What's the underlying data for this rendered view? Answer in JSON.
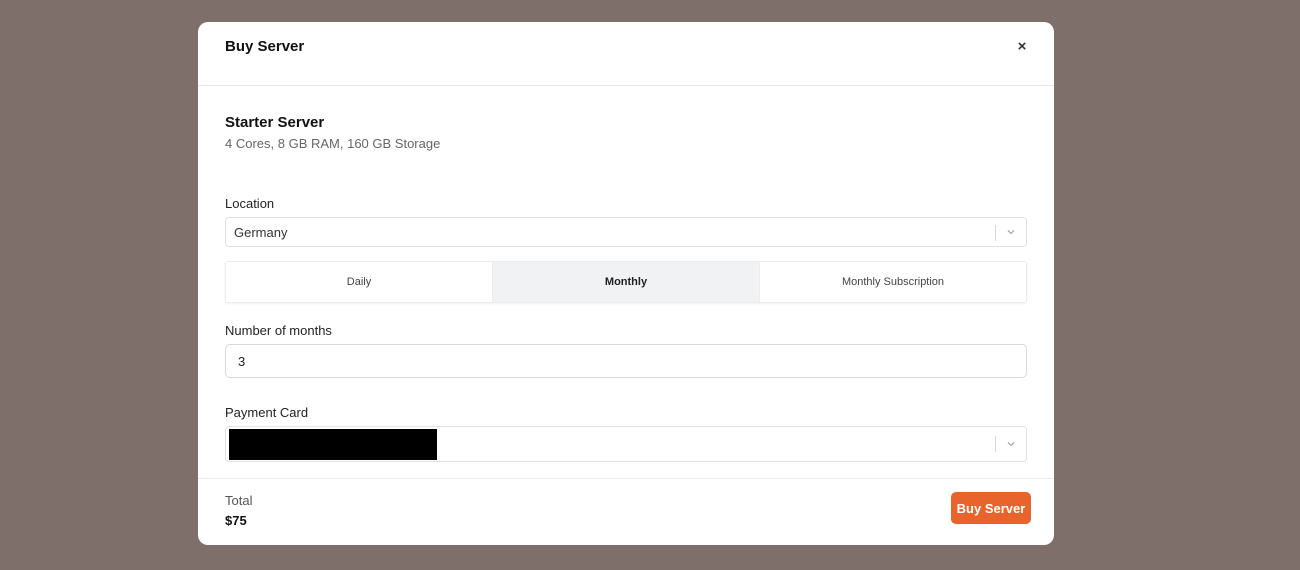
{
  "modal": {
    "title": "Buy Server",
    "close_icon": "×"
  },
  "product": {
    "name": "Starter Server",
    "specs": "4 Cores, 8 GB RAM, 160 GB Storage"
  },
  "location": {
    "label": "Location",
    "selected": "Germany"
  },
  "billing_tabs": {
    "items": [
      {
        "label": "Daily",
        "active": false
      },
      {
        "label": "Monthly",
        "active": true
      },
      {
        "label": "Monthly Subscription",
        "active": false
      }
    ]
  },
  "months": {
    "label": "Number of months",
    "value": "3"
  },
  "payment": {
    "label": "Payment Card"
  },
  "footer": {
    "total_label": "Total",
    "total_value": "$75",
    "buy_label": "Buy Server"
  },
  "colors": {
    "accent": "#e8642c",
    "backdrop": "#7e6f6a",
    "active_tab": "#f1f2f4"
  },
  "icons": {
    "close": "close-icon",
    "dropdown": "chevron-down-icon"
  }
}
